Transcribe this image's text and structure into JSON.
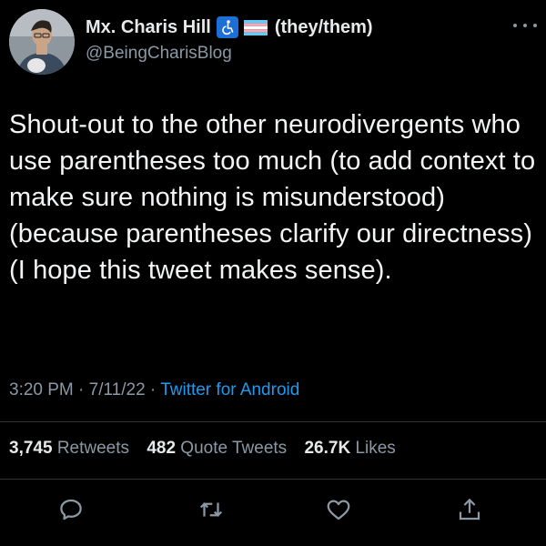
{
  "author": {
    "display_name": "Mx. Charis Hill",
    "pronouns": "(they/them)",
    "handle": "@BeingCharisBlog",
    "badges": [
      "accessibility-icon",
      "transgender-flag-icon"
    ]
  },
  "tweet": {
    "text": "Shout-out to the other neurodivergents who use parentheses too much (to add context to make sure nothing is misunderstood) (because parentheses clarify our directness) (I hope this tweet makes sense).",
    "time": "3:20 PM",
    "date": "7/11/22",
    "separator": "·",
    "source": "Twitter for Android"
  },
  "stats": {
    "retweets_count": "3,745",
    "retweets_label": "Retweets",
    "quotes_count": "482",
    "quotes_label": "Quote Tweets",
    "likes_count": "26.7K",
    "likes_label": "Likes"
  },
  "actions": [
    "reply-icon",
    "retweet-icon",
    "like-icon",
    "share-icon"
  ],
  "colors": {
    "background": "#000000",
    "text": "#e7e9ea",
    "secondary": "#8b98a5",
    "link": "#1d9bf0",
    "divider": "#2f3336"
  }
}
